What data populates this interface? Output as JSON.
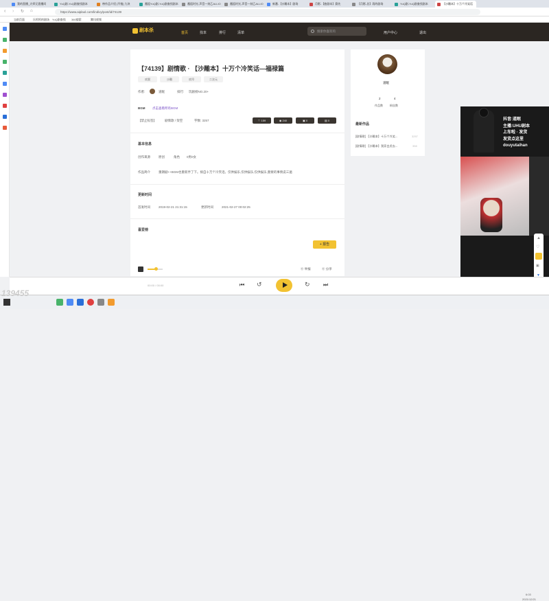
{
  "browser": {
    "tabs": [
      {
        "label": "我的直播_大师兄直播间",
        "color": "#4f8bf5"
      },
      {
        "label": "YuQ剧-YuQ剧查找剧本",
        "color": "#2aa198"
      },
      {
        "label": "带作品介绍 [不推] 九块",
        "color": "#e08020"
      },
      {
        "label": "邂逅YuQ剧-YuQ剧查找剧本",
        "color": "#2aa198"
      },
      {
        "label": "邂逅时光-声音一刻乙ALLIO",
        "color": "#888"
      },
      {
        "label": "邂逅时光-声音一刻乙ALLIO",
        "color": "#888"
      },
      {
        "label": "新番-【沙雕本】剧场",
        "color": "#4f8bf5"
      },
      {
        "label": "月影-【曲剧本】赛先",
        "color": "#c44"
      },
      {
        "label": "【月影-总】雨的剧场",
        "color": "#888"
      },
      {
        "label": "YuQ剧-YuQ剧查找剧本",
        "color": "#2aa198"
      },
      {
        "label": "【沙雕本】十万个冷笑话",
        "color": "#c44",
        "active": true
      }
    ],
    "url": "https://www.aiplaol.com/lindivy/post/id/74139",
    "bookmarks": [
      "当前页面",
      "乐呵呵的剧场",
      "YuQ剧查找",
      "360搜索",
      "腾讯视频"
    ]
  },
  "site": {
    "logo": "剧本杀",
    "nav": {
      "home": "首页",
      "find": "找本",
      "rank": "排行",
      "list": "清单"
    },
    "search_placeholder": "搜索你喜欢的",
    "user_center": "用户中心",
    "logout": "退出"
  },
  "post": {
    "title": "【74139】剧情歌  ·  【沙雕本】十万个冷笑话—福禄篇",
    "tags": [
      "欢脱",
      "沙雕",
      "欢叩",
      "二次元"
    ],
    "author_label": "作者:",
    "author_name": "道眠",
    "rank_label": "排行:",
    "rank_value": "玩剧榜NO.20+",
    "bgm_label": "BGM",
    "bgm_link": "点击查看所有BGM",
    "category": "【禁止标签】",
    "genre": "剧情歌 / 架空",
    "words": "字数: 3257",
    "stats": [
      "159",
      "240",
      "0",
      "0"
    ],
    "info_heading": "基本信息",
    "info_row": {
      "source": "创作来源",
      "source_val": "原创",
      "roles": "角色",
      "roles_val": "0男0女"
    },
    "intro_label": "作品简介",
    "intro_text": "重朗剧++BGM也重新弄了下。搞自十万个冷笑话。仅供娱乐,仅供娱乐,仅供娱乐,重要的事情说三遍",
    "update_heading": "更新时间",
    "created_label": "首发时间",
    "created_val": "2019-02-21 21:31:15",
    "updated_label": "更新时间",
    "updated_val": "2021-02-27 00:02:25",
    "comment_heading": "喜爱榜",
    "report_button": "+ 报告",
    "report_button_alt": "举报",
    "share": "分享"
  },
  "sidebar": {
    "author_name": "道眠",
    "works_count": "2",
    "works_label": "作品数",
    "fans_count": "4",
    "fans_label": "粉丝数",
    "latest_heading": "最新作品",
    "latest_items": [
      {
        "title": "[剧情歌] 【沙雕本】十万个冷笑...",
        "meta": "3257"
      },
      {
        "title": "[剧情歌] 【沙雕本】我家白虎去...",
        "meta": "358"
      }
    ]
  },
  "player": {
    "time": "00:00 / 00:00"
  },
  "overlay": {
    "lines": [
      "抖音:道眠",
      "主播:UHU剧本",
      "上车啦 · 发货",
      "发货点这里",
      "douyutaihan"
    ]
  },
  "watermark": "139455",
  "taskbar": {
    "time": "6:03",
    "date": "2021/12/21"
  }
}
